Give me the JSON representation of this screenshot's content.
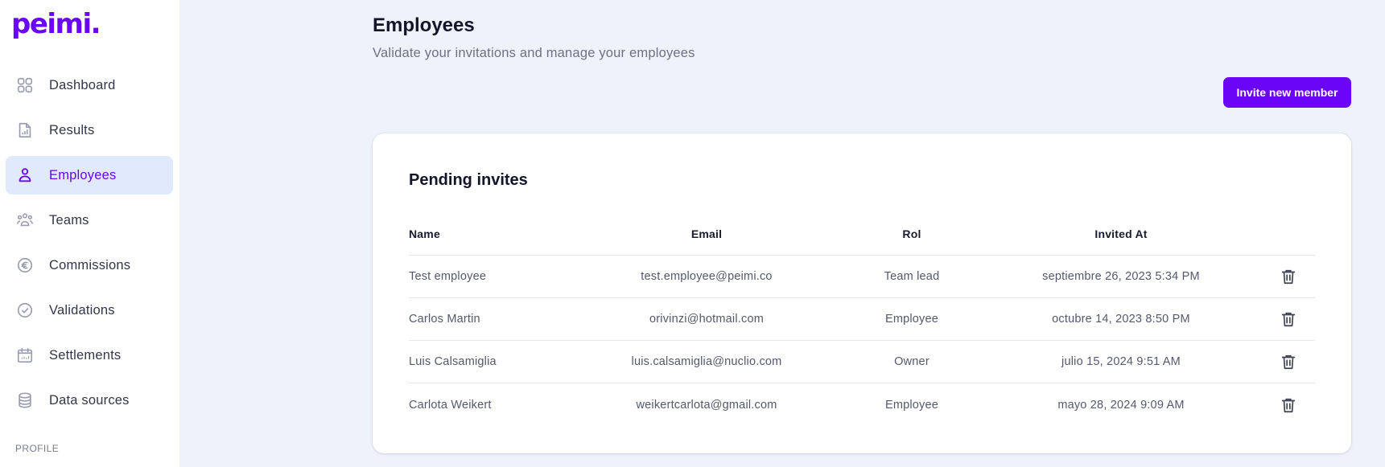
{
  "brand": {
    "logo": "peimi.",
    "accent": "#6a05f8"
  },
  "sidebar": {
    "items": [
      {
        "label": "Dashboard",
        "icon": "grid-icon",
        "active": false
      },
      {
        "label": "Results",
        "icon": "chart-file-icon",
        "active": false
      },
      {
        "label": "Employees",
        "icon": "user-icon",
        "active": true
      },
      {
        "label": "Teams",
        "icon": "team-icon",
        "active": false
      },
      {
        "label": "Commissions",
        "icon": "euro-icon",
        "active": false
      },
      {
        "label": "Validations",
        "icon": "check-circle-icon",
        "active": false
      },
      {
        "label": "Settlements",
        "icon": "calendar-icon",
        "active": false
      },
      {
        "label": "Data sources",
        "icon": "database-icon",
        "active": false
      }
    ],
    "section_label": "PROFILE"
  },
  "header": {
    "title": "Employees",
    "subtitle": "Validate your invitations and manage your employees",
    "invite_button": "Invite new member"
  },
  "pending": {
    "title": "Pending invites",
    "columns": [
      "Name",
      "Email",
      "Rol",
      "Invited At"
    ],
    "rows": [
      {
        "name": "Test employee",
        "email": "test.employee@peimi.co",
        "rol": "Team lead",
        "invited_at": "septiembre 26, 2023 5:34 PM"
      },
      {
        "name": "Carlos Martin",
        "email": "orivinzi@hotmail.com",
        "rol": "Employee",
        "invited_at": "octubre 14, 2023 8:50 PM"
      },
      {
        "name": "Luis Calsamiglia",
        "email": "luis.calsamiglia@nuclio.com",
        "rol": "Owner",
        "invited_at": "julio 15, 2024 9:51 AM"
      },
      {
        "name": "Carlota Weikert",
        "email": "weikertcarlota@gmail.com",
        "rol": "Employee",
        "invited_at": "mayo 28, 2024 9:09 AM"
      }
    ],
    "row_action_icon": "trash-icon"
  }
}
